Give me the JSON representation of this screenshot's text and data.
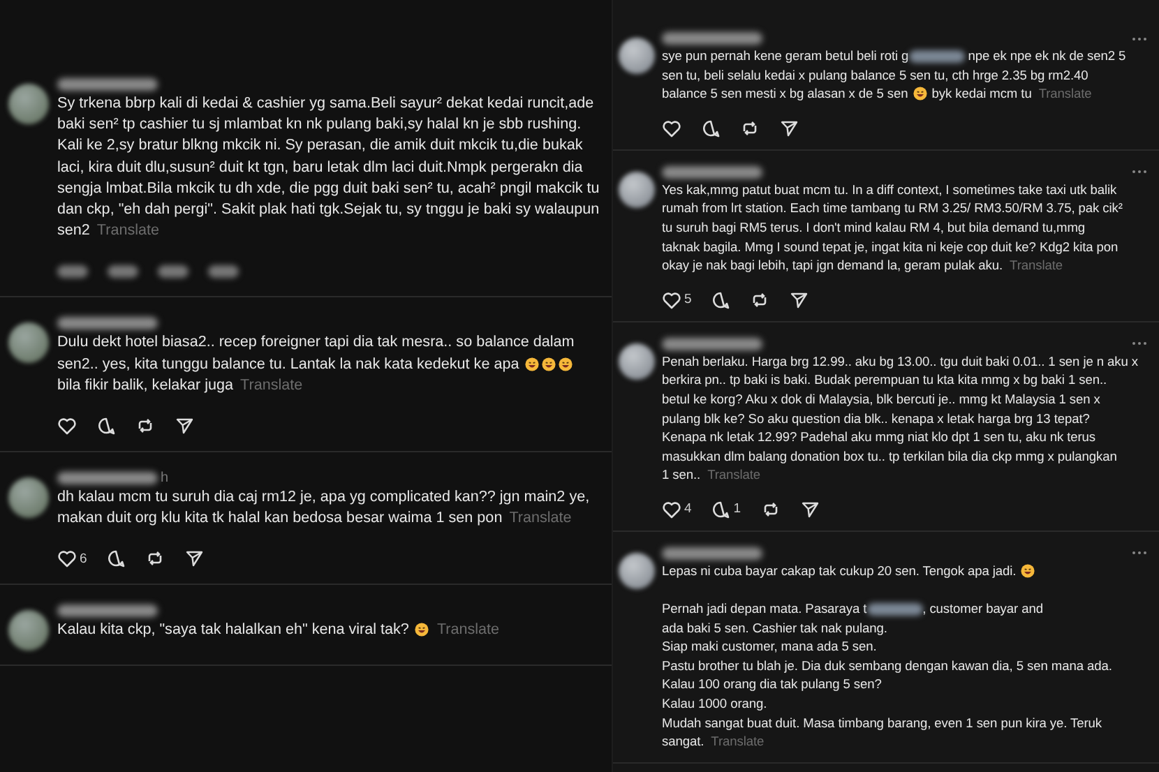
{
  "left_column": {
    "comments": [
      {
        "actions": {
          "kind": "blurred"
        },
        "body": [
          {
            "kind": "text",
            "text": "Sy trkena bbrp kali di kedai & cashier yg sama.Beli sayur² dekat kedai runcit,ade\nbaki sen² tp cashier tu sj mlambat kn nk pulang baki,sy halal kn je sbb rushing.\nKali ke 2,sy bratur blkng mkcik ni. Sy perasan, die amik duit mkcik tu,die bukak\nlaci, kira duit dlu,susun² duit kt tgn, baru letak dlm laci duit.Nmpk pergerakn dia\nsengja lmbat.Bila mkcik tu dh xde, die pgg duit baki sen² tu, acah² pngil makcik tu\ndan ckp, \"eh dah pergi\". Sakit plak hati tgk.Sejak tu, sy tnggu je baki sy walaupun\nsen2"
          }
        ],
        "translate": "Translate"
      },
      {
        "actions": {
          "kind": "icons"
        },
        "body": [
          {
            "kind": "text",
            "text": "Dulu dekt hotel biasa2.. recep foreigner tapi dia tak mesra.. so balance dalam\nsen2.. yes, kita tunggu balance tu. Lantak la nak kata kedekut ke apa "
          },
          {
            "kind": "emoji"
          },
          {
            "kind": "emoji"
          },
          {
            "kind": "emoji"
          },
          {
            "kind": "text",
            "text": "\nbila fikir balik, kelakar juga"
          }
        ],
        "translate": "Translate"
      },
      {
        "meta": "h",
        "actions": {
          "kind": "icons",
          "like_count": "6"
        },
        "body": [
          {
            "kind": "text",
            "text": "dh kalau mcm tu suruh dia caj rm12 je, apa yg complicated kan?? jgn main2 ye,\nmakan duit org klu kita tk halal kan bedosa besar waima 1 sen pon"
          }
        ],
        "translate": "Translate"
      },
      {
        "body": [
          {
            "kind": "text",
            "text": "Kalau kita ckp, \"saya tak halalkan eh\" kena viral tak? "
          },
          {
            "kind": "emoji"
          }
        ],
        "translate": "Translate"
      }
    ]
  },
  "right_column": {
    "comments": [
      {
        "actions": {
          "kind": "icons"
        },
        "body": [
          {
            "kind": "text",
            "text": "sye pun pernah kene geram betul beli roti g"
          },
          {
            "kind": "redacted"
          },
          {
            "kind": "text",
            "text": " npe ek npe ek nk de sen2 5\nsen tu, beli selalu kedai x pulang balance 5 sen tu, cth hrge 2.35 bg rm2.40\nbalance 5 sen mesti x bg alasan x de 5 sen "
          },
          {
            "kind": "emoji"
          },
          {
            "kind": "text",
            "text": " byk kedai mcm tu"
          }
        ],
        "translate": "Translate"
      },
      {
        "actions": {
          "kind": "icons",
          "like_count": "5"
        },
        "body": [
          {
            "kind": "text",
            "text": "Yes kak,mmg patut buat mcm tu. In a diff context, I sometimes take taxi utk balik\nrumah from lrt station. Each time tambang tu RM 3.25/ RM3.50/RM 3.75, pak cik²\ntu suruh bagi RM5 terus. I don't mind kalau RM 4, but bila demand tu,mmg\ntaknak bagila. Mmg I sound tepat je, ingat kita ni keje cop duit ke? Kdg2 kita pon\nokay je nak bagi lebih, tapi jgn demand la, geram pulak aku."
          }
        ],
        "translate": "Translate"
      },
      {
        "actions": {
          "kind": "icons",
          "like_count": "4",
          "reply_count": "1"
        },
        "body": [
          {
            "kind": "text",
            "text": "Penah berlaku. Harga brg 12.99.. aku bg 13.00.. tgu duit baki 0.01.. 1 sen je n aku x\nberkira pn.. tp baki is baki. Budak perempuan tu kta kita mmg x bg baki 1 sen..\nbetul ke korg? Aku x dok di Malaysia, blk bercuti je.. mmg kt Malaysia 1 sen x\npulang blk ke? So aku question dia blk.. kenapa x letak harga brg 13 tepat?\nKenapa nk letak 12.99? Padehal aku mmg niat klo dpt 1 sen tu, aku nk terus\nmasukkan dlm balang donation box tu.. tp terkilan bila dia ckp mmg x pulangkan\n1 sen.."
          }
        ],
        "translate": "Translate"
      },
      {
        "body": [
          {
            "kind": "text",
            "text": "Lepas ni cuba bayar cakap tak cukup 20 sen. Tengok apa jadi. "
          },
          {
            "kind": "emoji"
          },
          {
            "kind": "text",
            "text": "\n\nPernah jadi depan mata. Pasaraya t"
          },
          {
            "kind": "redacted"
          },
          {
            "kind": "text",
            "text": ", customer bayar and\nada baki 5 sen. Cashier tak nak pulang.\nSiap maki customer, mana ada 5 sen.\nPastu brother tu blah je. Dia duk sembang dengan kawan dia, 5 sen mana ada.\nKalau 100 orang dia tak pulang 5 sen?\nKalau 1000 orang.\nMudah sangat buat duit. Masa timbang barang, even 1 sen pun kira ye. Teruk\nsangat."
          }
        ],
        "translate": "Translate"
      }
    ]
  }
}
